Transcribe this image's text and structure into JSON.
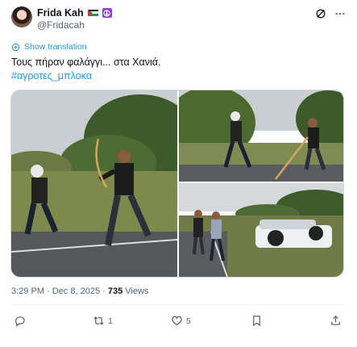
{
  "author": {
    "display_name": "Frida Kah",
    "handle": "@Fridacah"
  },
  "header": {
    "grok_icon": "grok-icon",
    "more_icon": "more-dots-icon"
  },
  "translate": {
    "label": "Show translation",
    "icon": "translate-icon"
  },
  "tweet": {
    "text": "Τους πήραν φαλάγγι... στα Χανιά.",
    "hashtag": "#αγροτες_μπλοκα"
  },
  "media": {
    "photos": [
      "photo-1",
      "photo-2",
      "photo-3"
    ]
  },
  "meta": {
    "timestamp": "3:29 PM · Dec 8, 2025 · ",
    "views_count": "735",
    "views_label": " Views"
  },
  "actions": {
    "reply_count": "",
    "retweet_count": "1",
    "like_count": "5"
  },
  "colors": {
    "link": "#1d9bf0",
    "secondary": "#536471",
    "primary_text": "#0f1419"
  }
}
